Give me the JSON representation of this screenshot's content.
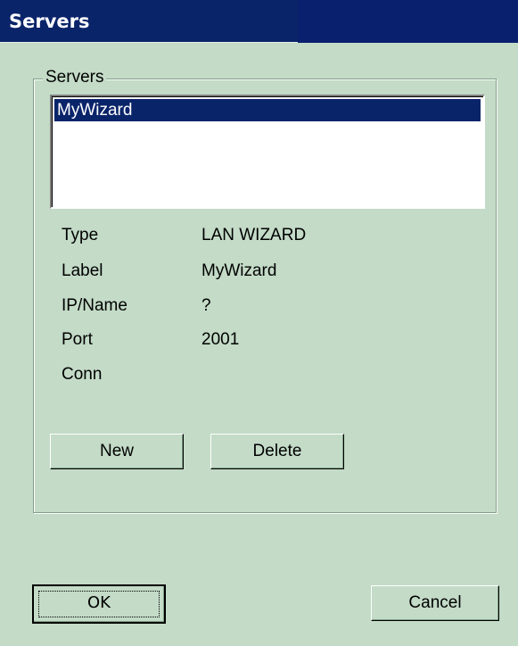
{
  "window": {
    "title": "Servers"
  },
  "group": {
    "legend": "Servers"
  },
  "server_list": {
    "items": [
      "MyWizard"
    ],
    "selected_index": 0
  },
  "details": {
    "type_label": "Type",
    "type_value": "LAN WIZARD",
    "label_label": "Label",
    "label_value": "MyWizard",
    "ip_label": "IP/Name",
    "ip_value": "?",
    "port_label": "Port",
    "port_value": "2001",
    "conn_label": "Conn",
    "conn_value": ""
  },
  "buttons": {
    "new": "New",
    "delete": "Delete",
    "ok": "OK",
    "cancel": "Cancel"
  },
  "colors": {
    "title_bar": "#0a246a",
    "dialog_background": "#c3dbc7",
    "selection": "#0a246a"
  }
}
